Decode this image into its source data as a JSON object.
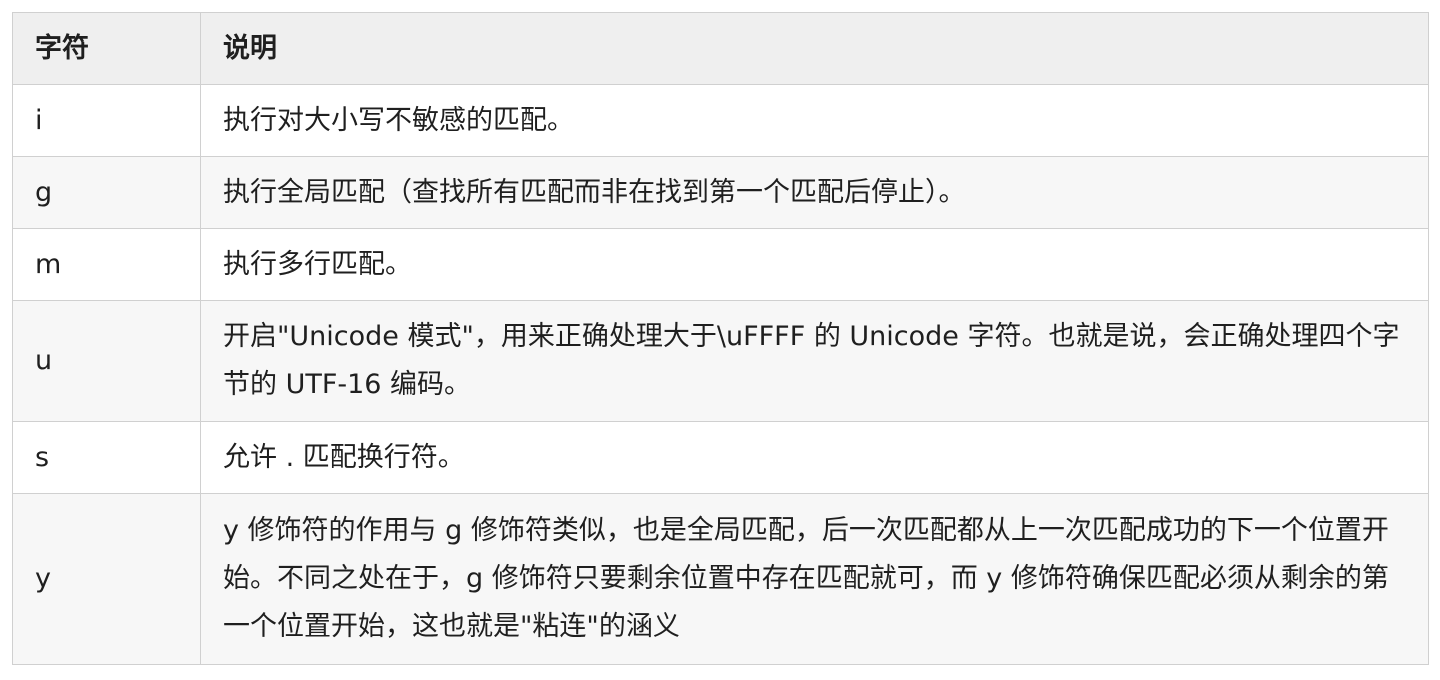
{
  "table": {
    "headers": [
      "字符",
      "说明"
    ],
    "rows": [
      {
        "flag": "i",
        "desc": "执行对大小写不敏感的匹配。"
      },
      {
        "flag": "g",
        "desc": "执行全局匹配（查找所有匹配而非在找到第一个匹配后停止）。"
      },
      {
        "flag": "m",
        "desc": "执行多行匹配。"
      },
      {
        "flag": "u",
        "desc": "开启\"Unicode 模式\"，用来正确处理大于\\uFFFF 的 Unicode 字符。也就是说，会正确处理四个字节的 UTF-16 编码。"
      },
      {
        "flag": "s",
        "desc": "允许 . 匹配换行符。"
      },
      {
        "flag": "y",
        "desc": "y 修饰符的作用与 g 修饰符类似，也是全局匹配，后一次匹配都从上一次匹配成功的下一个位置开始。不同之处在于，g 修饰符只要剩余位置中存在匹配就可，而 y 修饰符确保匹配必须从剩余的第一个位置开始，这也就是\"粘连\"的涵义"
      }
    ]
  }
}
